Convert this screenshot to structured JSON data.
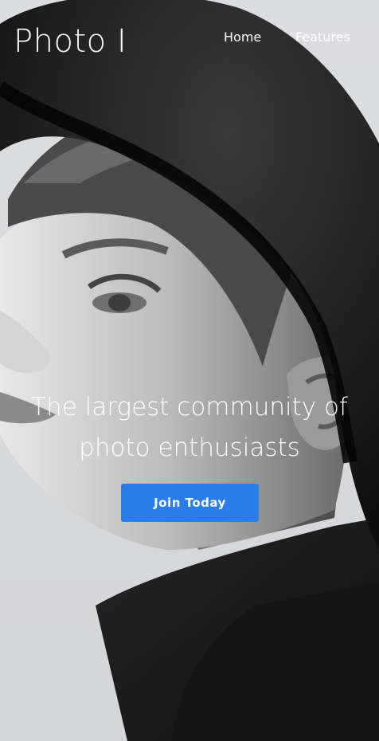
{
  "nav": {
    "brand": "Photo I",
    "links": [
      {
        "label": "Home"
      },
      {
        "label": "Features"
      }
    ]
  },
  "hero": {
    "headline_line1": "The largest community of",
    "headline_line2": "photo enthusiasts",
    "cta_label": "Join Today",
    "cta_color": "#2b7de9",
    "image": "portrait-photo"
  }
}
